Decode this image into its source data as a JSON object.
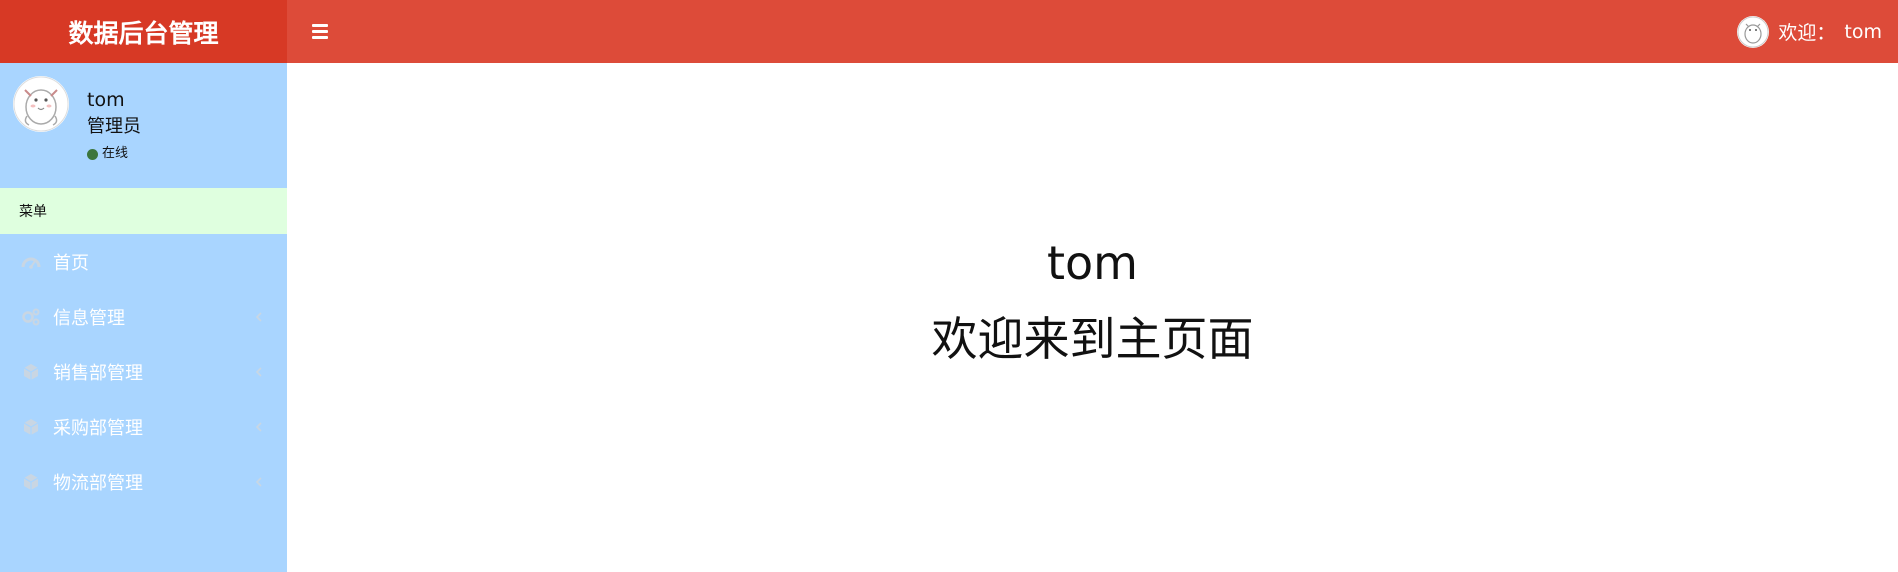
{
  "header": {
    "logo": "数据后台管理",
    "welcome_label": "欢迎：",
    "username": "tom"
  },
  "sidebar": {
    "user": {
      "name": "tom",
      "role": "管理员",
      "status": "在线",
      "status_color": "#3c763d"
    },
    "menu_header": "菜单",
    "items": [
      {
        "label": "首页",
        "icon": "dashboard-icon",
        "has_submenu": false
      },
      {
        "label": "信息管理",
        "icon": "cogs-icon",
        "has_submenu": true
      },
      {
        "label": "销售部管理",
        "icon": "cube-icon",
        "has_submenu": true
      },
      {
        "label": "采购部管理",
        "icon": "cube-icon",
        "has_submenu": true
      },
      {
        "label": "物流部管理",
        "icon": "cube-icon",
        "has_submenu": true
      }
    ]
  },
  "main": {
    "name": "tom",
    "welcome": "欢迎来到主页面"
  },
  "colors": {
    "logo_bg": "#d73925",
    "navbar_bg": "#dd4b39",
    "sidebar_bg": "#a9d5ff",
    "menu_header_bg": "#dfffdf"
  }
}
